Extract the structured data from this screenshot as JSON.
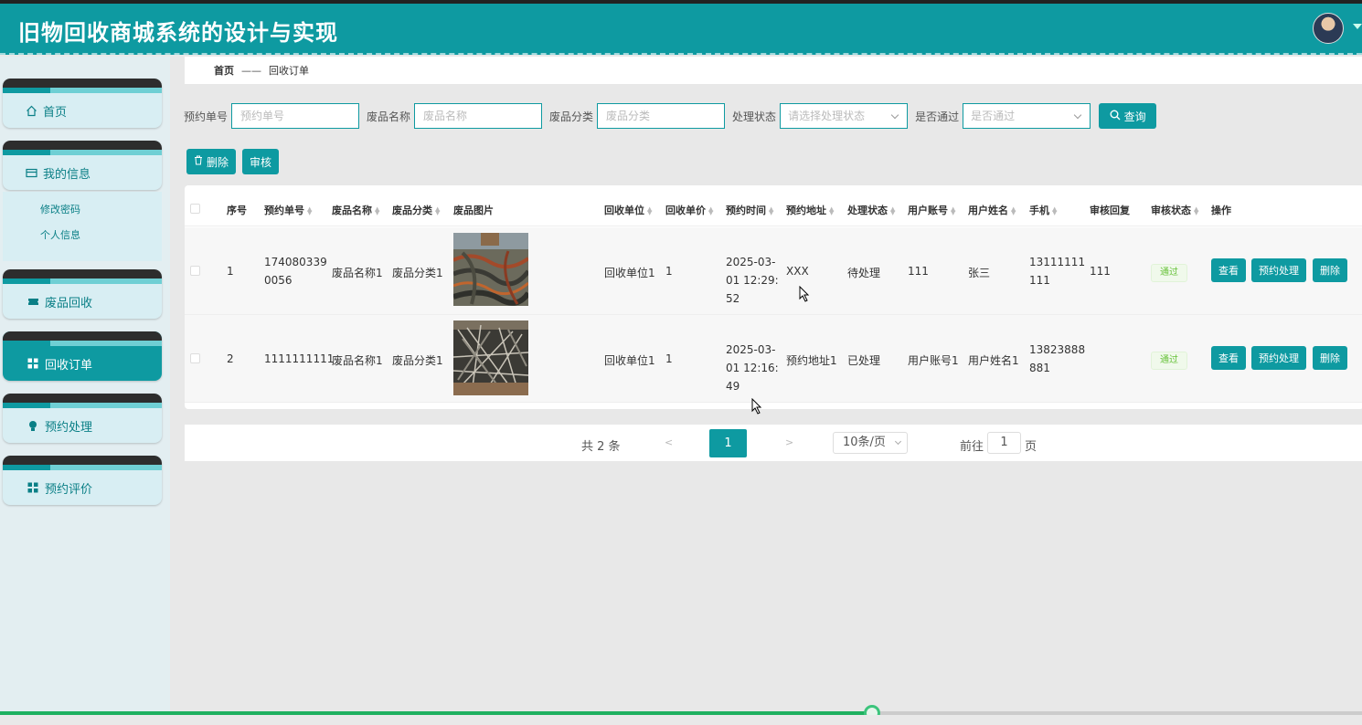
{
  "app": {
    "title": "旧物回收商城系统的设计与实现"
  },
  "sidebar": {
    "home": "首页",
    "my_info": "我的信息",
    "sub_items": [
      "修改密码",
      "个人信息"
    ],
    "waste_recycle": "废品回收",
    "recycle_orders": "回收订单",
    "appointment_process": "预约处理",
    "appointment_review": "预约评价"
  },
  "breadcrumb": {
    "home": "首页",
    "sep": "——",
    "current": "回收订单"
  },
  "search": {
    "label1": "预约单号",
    "ph1": "预约单号",
    "label2": "废品名称",
    "ph2": "废品名称",
    "label3": "废品分类",
    "ph3": "废品分类",
    "label4": "处理状态",
    "ph4": "请选择处理状态",
    "label5": "是否通过",
    "ph5": "是否通过",
    "query": "查询"
  },
  "actions": {
    "delete": "删除",
    "audit": "审核"
  },
  "table": {
    "headers": [
      "序号",
      "预约单号",
      "废品名称",
      "废品分类",
      "废品图片",
      "回收单位",
      "回收单价",
      "预约时间",
      "预约地址",
      "处理状态",
      "用户账号",
      "用户姓名",
      "手机",
      "审核回复",
      "审核状态",
      "操作"
    ],
    "rows": [
      {
        "index": "1",
        "order_no": "1740803390056",
        "name": "废品名称1",
        "category": "废品分类1",
        "unit": "回收单位1",
        "price": "1",
        "time": "2025-03-01 12:29:52",
        "address": "XXX",
        "status": "待处理",
        "account": "111",
        "user": "张三",
        "phone": "13111111111",
        "reply": "111",
        "audit": "通过"
      },
      {
        "index": "2",
        "order_no": "1111111111",
        "name": "废品名称1",
        "category": "废品分类1",
        "unit": "回收单位1",
        "price": "1",
        "time": "2025-03-01 12:16:49",
        "address": "预约地址1",
        "status": "已处理",
        "account": "用户账号1",
        "user": "用户姓名1",
        "phone": "13823888881",
        "reply": "",
        "audit": "通过"
      }
    ],
    "row_buttons": {
      "view": "查看",
      "process": "预约处理",
      "delete": "删除"
    }
  },
  "pager": {
    "total": "共 2 条",
    "prev": "<",
    "page": "1",
    "next": ">",
    "size": "10条/页",
    "goto": "前往",
    "goto_value": "1",
    "page_suffix": "页"
  },
  "video": {
    "progress": 0.64
  },
  "colors": {
    "accent": "#0e9aa1",
    "success": "#67c23a"
  }
}
